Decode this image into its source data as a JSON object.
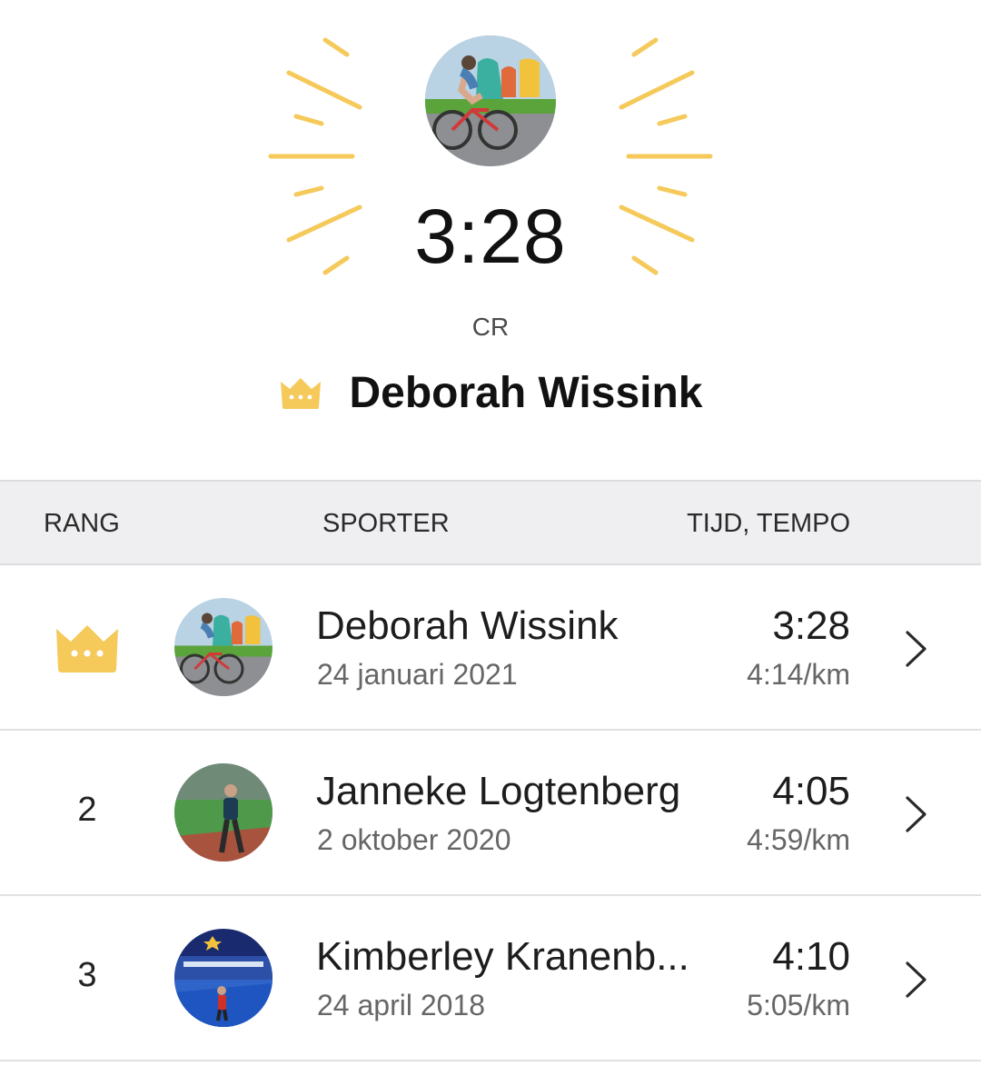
{
  "hero": {
    "time": "3:28",
    "label": "CR",
    "name": "Deborah Wissink",
    "avatar_icon": "cyclist-photo-avatar",
    "crown_icon": "crown-icon",
    "accent_color": "#f5c95a"
  },
  "table": {
    "headers": {
      "rank": "RANG",
      "athlete": "SPORTER",
      "time_pace": "TIJD, TEMPO"
    },
    "rows": [
      {
        "rank": "",
        "rank_icon": "crown-icon",
        "name": "Deborah Wissink",
        "date": "24 januari 2021",
        "time": "3:28",
        "pace": "4:14/km"
      },
      {
        "rank": "2",
        "name": "Janneke Logtenberg",
        "date": "2 oktober 2020",
        "time": "4:05",
        "pace": "4:59/km"
      },
      {
        "rank": "3",
        "name": "Kimberley Kranenb...",
        "date": "24 april 2018",
        "time": "4:10",
        "pace": "5:05/km"
      }
    ]
  }
}
